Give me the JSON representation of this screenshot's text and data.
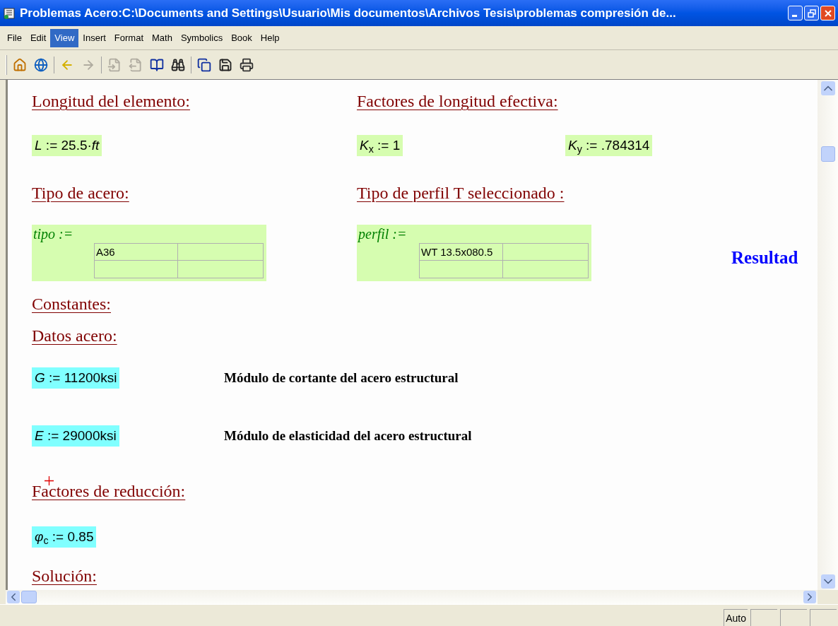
{
  "window": {
    "title": "Problemas Acero:C:\\Documents and Settings\\Usuario\\Mis documentos\\Archivos Tesis\\problemas compresión de..."
  },
  "menu": [
    {
      "label": "File",
      "selected": false
    },
    {
      "label": "Edit",
      "selected": false
    },
    {
      "label": "View",
      "selected": true
    },
    {
      "label": "Insert",
      "selected": false
    },
    {
      "label": "Format",
      "selected": false
    },
    {
      "label": "Math",
      "selected": false
    },
    {
      "label": "Symbolics",
      "selected": false
    },
    {
      "label": "Book",
      "selected": false
    },
    {
      "label": "Help",
      "selected": false
    }
  ],
  "toolbar_groups": [
    {
      "buttons": [
        {
          "kind": "home",
          "disabled": false
        },
        {
          "kind": "globe",
          "disabled": false
        }
      ]
    },
    {
      "buttons": [
        {
          "kind": "back",
          "disabled": false
        },
        {
          "kind": "forward",
          "disabled": true
        }
      ]
    },
    {
      "buttons": [
        {
          "kind": "page_back",
          "disabled": true
        },
        {
          "kind": "page_forward",
          "disabled": true
        },
        {
          "kind": "open_page",
          "disabled": false
        },
        {
          "kind": "find",
          "disabled": false
        }
      ]
    },
    {
      "buttons": [
        {
          "kind": "copy",
          "disabled": false
        },
        {
          "kind": "save",
          "disabled": false
        },
        {
          "kind": "print",
          "disabled": false
        }
      ]
    }
  ],
  "worksheet": {
    "rows": [
      {
        "items": [
          {
            "kind": "heading",
            "text": "Longitud del elemento:"
          },
          {
            "kind": "heading",
            "text": "Factores de longitud efectiva:"
          }
        ]
      },
      {
        "items": [
          {
            "kind": "math",
            "color": "#d6fdb0",
            "expr": "*L* := 25.5·*ft*"
          },
          {
            "kind": "math",
            "color": "#d6fdb0",
            "expr": "*K*$_{x}$ := 1"
          },
          {
            "kind": "math",
            "color": "#d6fdb0",
            "expr": "*K*$_{y}$ := .784314"
          }
        ]
      },
      {
        "items": [
          {
            "kind": "heading",
            "text": "Tipo de acero:"
          },
          {
            "kind": "heading",
            "text": "Tipo de perfil T seleccionado :"
          }
        ]
      },
      {
        "items": [
          {
            "kind": "table",
            "name": "tipo :=",
            "value": "A36"
          },
          {
            "kind": "table",
            "name": "perfil :=",
            "value": "WT 13.5x080.5"
          },
          {
            "kind": "result",
            "text": "Resultad"
          }
        ]
      },
      {
        "items": [
          {
            "kind": "heading",
            "text": "Constantes:"
          }
        ]
      },
      {
        "items": [
          {
            "kind": "heading",
            "text": "Datos acero:"
          }
        ]
      },
      {
        "items": [
          {
            "kind": "math",
            "color": "#80ffff",
            "expr": "*G* := 11200ksi"
          },
          {
            "kind": "note",
            "text": "Módulo de cortante del acero estructural"
          }
        ]
      },
      {
        "items": [
          {
            "kind": "math",
            "color": "#80ffff",
            "expr": "*E* := 29000ksi"
          },
          {
            "kind": "note",
            "text": "Módulo de elasticidad del acero estructural"
          }
        ]
      },
      {
        "items": [
          {
            "kind": "heading",
            "text": "Factores de reducción:",
            "cursor": true
          }
        ]
      },
      {
        "items": [
          {
            "kind": "math",
            "color": "#80ffff",
            "expr": "*φ*$_{c}$ := 0.85"
          }
        ]
      },
      {
        "items": [
          {
            "kind": "heading",
            "text": "Solución:"
          }
        ]
      }
    ]
  },
  "status_bar": {
    "panels": [
      "Auto"
    ]
  }
}
